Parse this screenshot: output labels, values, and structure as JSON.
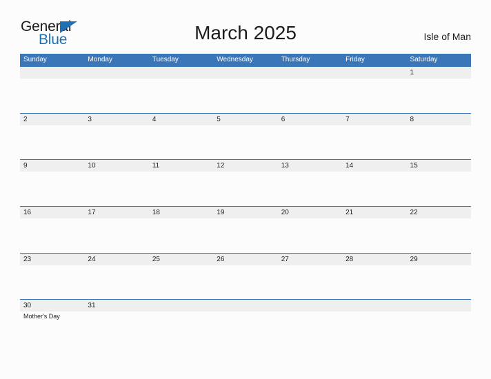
{
  "brand": {
    "name_part1": "General",
    "name_part2": "Blue",
    "triangle_color": "#1f6fb5",
    "text_color": "#1c1c1c"
  },
  "header": {
    "title": "March 2025",
    "locale": "Isle of Man"
  },
  "colors": {
    "header_blue": "#3b77b8",
    "band_gray": "#efefef",
    "page_background": "#fcfcfc",
    "text": "#1c1c1c"
  },
  "calendar": {
    "weekdays": [
      "Sunday",
      "Monday",
      "Tuesday",
      "Wednesday",
      "Thursday",
      "Friday",
      "Saturday"
    ],
    "weeks": [
      [
        {
          "day": "",
          "events": []
        },
        {
          "day": "",
          "events": []
        },
        {
          "day": "",
          "events": []
        },
        {
          "day": "",
          "events": []
        },
        {
          "day": "",
          "events": []
        },
        {
          "day": "",
          "events": []
        },
        {
          "day": "1",
          "events": []
        }
      ],
      [
        {
          "day": "2",
          "events": []
        },
        {
          "day": "3",
          "events": []
        },
        {
          "day": "4",
          "events": []
        },
        {
          "day": "5",
          "events": []
        },
        {
          "day": "6",
          "events": []
        },
        {
          "day": "7",
          "events": []
        },
        {
          "day": "8",
          "events": []
        }
      ],
      [
        {
          "day": "9",
          "events": []
        },
        {
          "day": "10",
          "events": []
        },
        {
          "day": "11",
          "events": []
        },
        {
          "day": "12",
          "events": []
        },
        {
          "day": "13",
          "events": []
        },
        {
          "day": "14",
          "events": []
        },
        {
          "day": "15",
          "events": []
        }
      ],
      [
        {
          "day": "16",
          "events": []
        },
        {
          "day": "17",
          "events": []
        },
        {
          "day": "18",
          "events": []
        },
        {
          "day": "19",
          "events": []
        },
        {
          "day": "20",
          "events": []
        },
        {
          "day": "21",
          "events": []
        },
        {
          "day": "22",
          "events": []
        }
      ],
      [
        {
          "day": "23",
          "events": []
        },
        {
          "day": "24",
          "events": []
        },
        {
          "day": "25",
          "events": []
        },
        {
          "day": "26",
          "events": []
        },
        {
          "day": "27",
          "events": []
        },
        {
          "day": "28",
          "events": []
        },
        {
          "day": "29",
          "events": []
        }
      ],
      [
        {
          "day": "30",
          "events": [
            "Mother's Day"
          ]
        },
        {
          "day": "31",
          "events": []
        },
        {
          "day": "",
          "events": []
        },
        {
          "day": "",
          "events": []
        },
        {
          "day": "",
          "events": []
        },
        {
          "day": "",
          "events": []
        },
        {
          "day": "",
          "events": []
        }
      ]
    ]
  }
}
